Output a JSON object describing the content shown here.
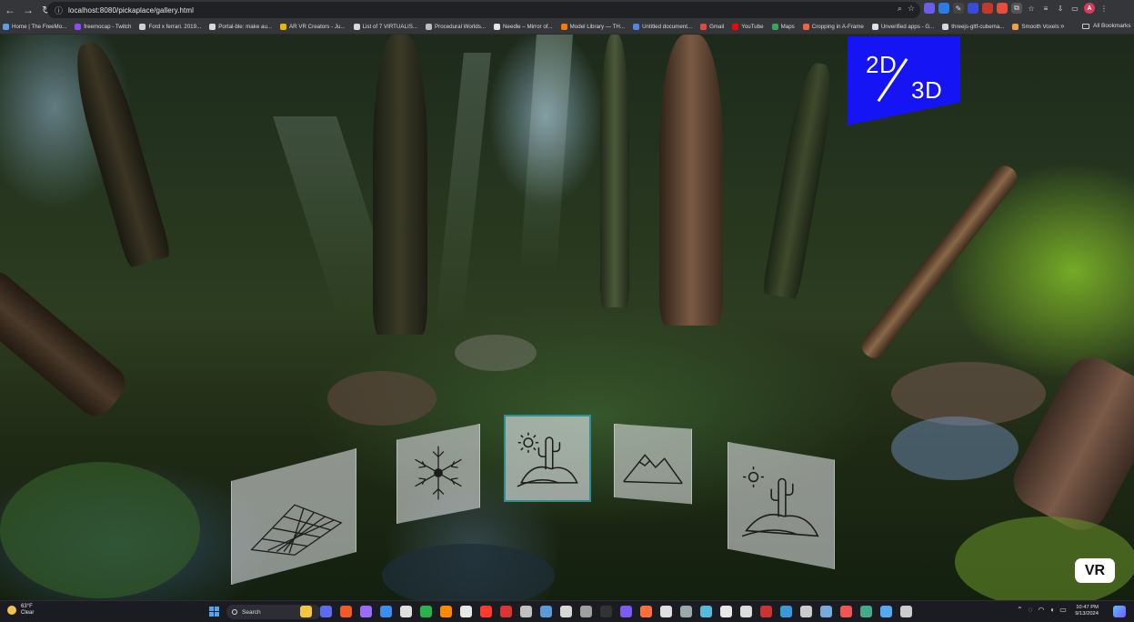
{
  "browser": {
    "url": "localhost:8080/pickaplace/gallery.html",
    "avatar_letter": "A",
    "bookmarks": [
      {
        "label": "Home | The FreeMo...",
        "color": "#5a9cf0"
      },
      {
        "label": "freemocap - Twitch",
        "color": "#9146ff"
      },
      {
        "label": "Ford x ferrari. 2019...",
        "color": "#cfcfcf"
      },
      {
        "label": "Portal-ble: make au...",
        "color": "#d8d8d8"
      },
      {
        "label": "AR VR Creators - Ju...",
        "color": "#f0b400"
      },
      {
        "label": "List of 7 VIRTUALIS...",
        "color": "#d8d8d8"
      },
      {
        "label": "Procedural Worlds...",
        "color": "#bdbdbd"
      },
      {
        "label": "Needle – Mirror of...",
        "color": "#e5e5e5"
      },
      {
        "label": "Model Library — TH...",
        "color": "#f57c00"
      },
      {
        "label": "Untitled document...",
        "color": "#4a86f0"
      },
      {
        "label": "Gmail",
        "color": "#e04a3a"
      },
      {
        "label": "YouTube",
        "color": "#ff0000"
      },
      {
        "label": "Maps",
        "color": "#34a853"
      },
      {
        "label": "Cropping in A-Frame",
        "color": "#f0643a"
      },
      {
        "label": "Unverified apps - G...",
        "color": "#e0e0e0"
      },
      {
        "label": "threejs-gltf-cubema...",
        "color": "#d8d8d8"
      },
      {
        "label": "Smooth Voxels",
        "color": "#f0a040"
      }
    ],
    "more_bookmarks": "»",
    "all_bookmarks": "All Bookmarks"
  },
  "scene": {
    "toggle": {
      "top": "2D",
      "bottom": "3D"
    },
    "vr_label": "VR",
    "panels": [
      {
        "name": "plane-grid-panel",
        "icon": "wireframe-plane-icon",
        "selected": false
      },
      {
        "name": "snowflake-panel",
        "icon": "snowflake-icon",
        "selected": false
      },
      {
        "name": "desert-panel",
        "icon": "desert-cactus-icon",
        "selected": true
      },
      {
        "name": "mountain-panel",
        "icon": "mountain-icon",
        "selected": false
      },
      {
        "name": "desert-panel-2",
        "icon": "desert-cactus-icon",
        "selected": false
      }
    ]
  },
  "taskbar": {
    "temperature": "63°F",
    "condition": "Clear",
    "search_placeholder": "Search",
    "time": "10:47 PM",
    "date": "9/13/2024",
    "apps": [
      "#f5c542",
      "#5b6cf0",
      "#f05a28",
      "#9b6bff",
      "#3c8df0",
      "#e0e0e0",
      "#2bb24c",
      "#ff8a00",
      "#e8e8e8",
      "#ff3b30",
      "#d33",
      "#c0c0c0",
      "#5b9bd5",
      "#d8d8d8",
      "#a0a0a0",
      "#333",
      "#7a5cf0",
      "#ff6f3c",
      "#e0e0e0",
      "#9aa",
      "#5bd",
      "#e8e8e8",
      "#dcdcdc",
      "#c33",
      "#3a9ad9",
      "#ccc",
      "#7ad",
      "#e55",
      "#4a8",
      "#5ae",
      "#ccc"
    ]
  }
}
